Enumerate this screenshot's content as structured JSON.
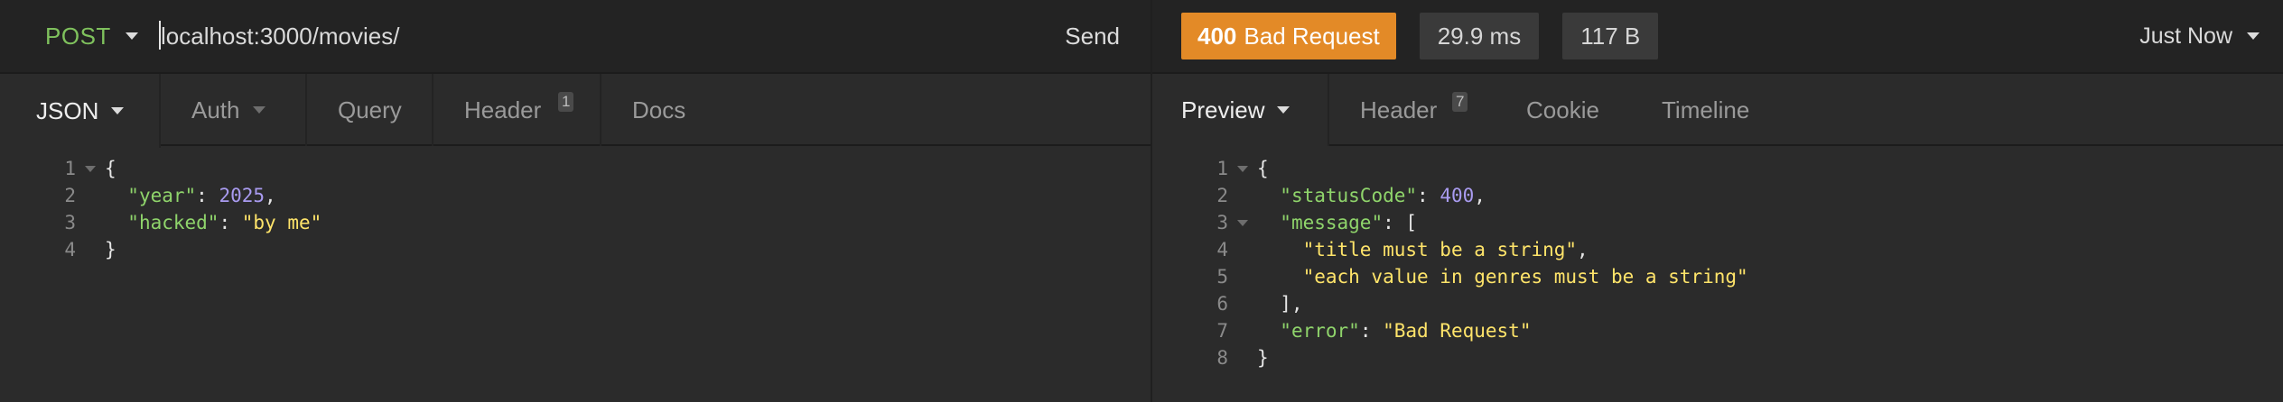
{
  "request": {
    "method": "POST",
    "url": "localhost:3000/movies/",
    "send_label": "Send",
    "tabs": [
      {
        "label": "JSON"
      },
      {
        "label": "Auth"
      },
      {
        "label": "Query"
      },
      {
        "label": "Header",
        "count": "1"
      },
      {
        "label": "Docs"
      }
    ],
    "body_lines": [
      {
        "n": "1",
        "fold": true,
        "tokens": [
          {
            "t": "{",
            "c": "punc"
          }
        ]
      },
      {
        "n": "2",
        "tokens": [
          {
            "t": "  ",
            "c": "punc"
          },
          {
            "t": "\"year\"",
            "c": "key"
          },
          {
            "t": ": ",
            "c": "punc"
          },
          {
            "t": "2025",
            "c": "num"
          },
          {
            "t": ",",
            "c": "punc"
          }
        ]
      },
      {
        "n": "3",
        "tokens": [
          {
            "t": "  ",
            "c": "punc"
          },
          {
            "t": "\"hacked\"",
            "c": "key"
          },
          {
            "t": ": ",
            "c": "punc"
          },
          {
            "t": "\"by me\"",
            "c": "str"
          }
        ]
      },
      {
        "n": "4",
        "tokens": [
          {
            "t": "}",
            "c": "punc"
          }
        ]
      }
    ]
  },
  "response": {
    "status_code": "400",
    "status_text": "Bad Request",
    "time": "29.9 ms",
    "size": "117 B",
    "history_label": "Just Now",
    "tabs": [
      {
        "label": "Preview"
      },
      {
        "label": "Header",
        "count": "7"
      },
      {
        "label": "Cookie"
      },
      {
        "label": "Timeline"
      }
    ],
    "body_lines": [
      {
        "n": "1",
        "fold": true,
        "tokens": [
          {
            "t": "{",
            "c": "punc"
          }
        ]
      },
      {
        "n": "2",
        "tokens": [
          {
            "t": "  ",
            "c": "punc"
          },
          {
            "t": "\"statusCode\"",
            "c": "key"
          },
          {
            "t": ": ",
            "c": "punc"
          },
          {
            "t": "400",
            "c": "num"
          },
          {
            "t": ",",
            "c": "punc"
          }
        ]
      },
      {
        "n": "3",
        "fold": true,
        "tokens": [
          {
            "t": "  ",
            "c": "punc"
          },
          {
            "t": "\"message\"",
            "c": "key"
          },
          {
            "t": ": [",
            "c": "punc"
          }
        ]
      },
      {
        "n": "4",
        "tokens": [
          {
            "t": "    ",
            "c": "punc"
          },
          {
            "t": "\"title must be a string\"",
            "c": "str"
          },
          {
            "t": ",",
            "c": "punc"
          }
        ]
      },
      {
        "n": "5",
        "tokens": [
          {
            "t": "    ",
            "c": "punc"
          },
          {
            "t": "\"each value in genres must be a string\"",
            "c": "str"
          }
        ]
      },
      {
        "n": "6",
        "tokens": [
          {
            "t": "  ],",
            "c": "punc"
          }
        ]
      },
      {
        "n": "7",
        "tokens": [
          {
            "t": "  ",
            "c": "punc"
          },
          {
            "t": "\"error\"",
            "c": "key"
          },
          {
            "t": ": ",
            "c": "punc"
          },
          {
            "t": "\"Bad Request\"",
            "c": "str"
          }
        ]
      },
      {
        "n": "8",
        "tokens": [
          {
            "t": "}",
            "c": "punc"
          }
        ]
      }
    ]
  },
  "colors": {
    "method_post": "#7fc15d",
    "status_error": "#e38a27",
    "json_key": "#8fd46b",
    "json_number": "#a99bf0",
    "json_string": "#ffe46a"
  },
  "icons": [
    "chevron-down-icon",
    "fold-arrow-icon"
  ]
}
